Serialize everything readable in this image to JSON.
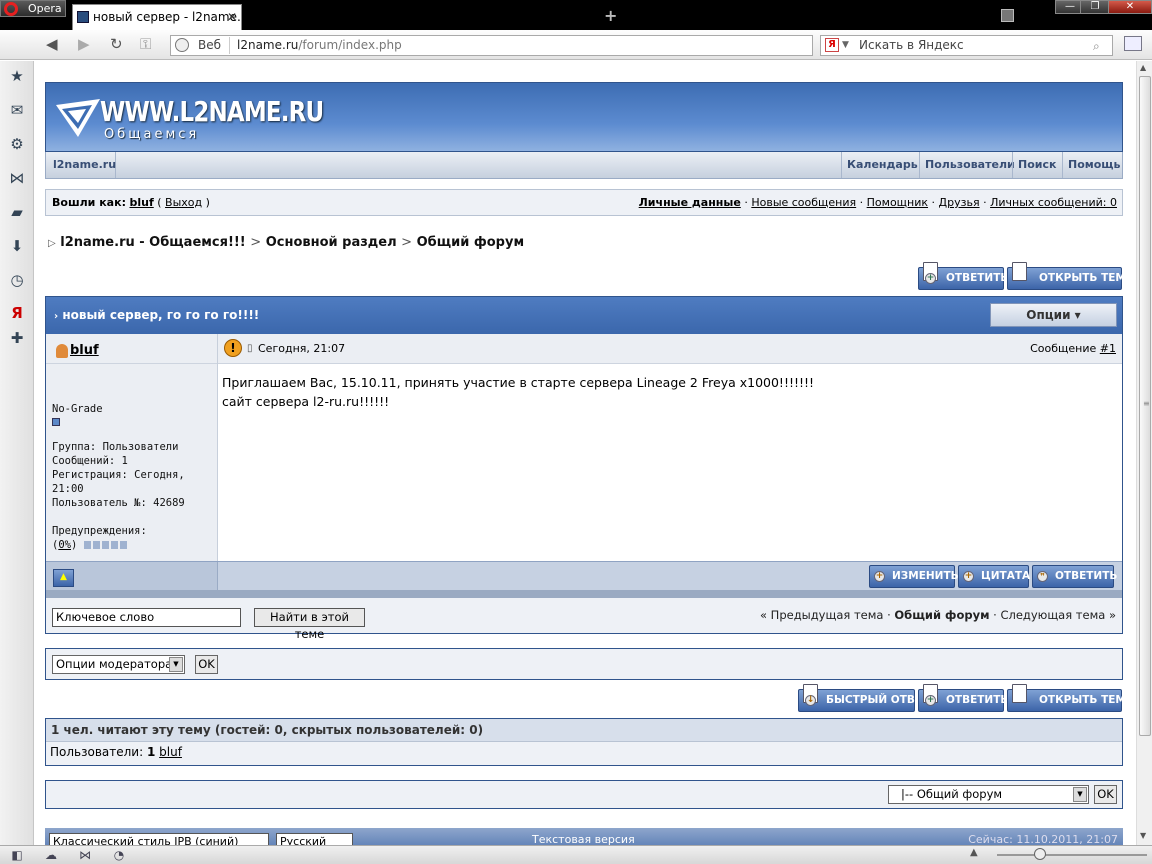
{
  "browser": {
    "menu_label": "Opera",
    "tab_title": "новый сервер - l2name....",
    "tab_close": "✕",
    "new_tab": "+",
    "window_buttons": [
      "—",
      "❐",
      "✕"
    ],
    "address_label": "Веб",
    "address_host": "l2name.ru",
    "address_path": "/forum/index.php",
    "search_engine": "Я",
    "search_placeholder": "Искать в Яндекс"
  },
  "sidebar": {
    "icons": [
      "star-icon",
      "mail-icon",
      "gear-icon",
      "unite-icon",
      "notes-icon",
      "downloads-icon",
      "history-icon",
      "yandex-icon",
      "plus-icon"
    ]
  },
  "forum": {
    "logo_title": "WWW.L2NAME.RU",
    "logo_subtitle": "Общаемся",
    "menu_home": "l2name.ru",
    "menu_items": [
      "Календарь",
      "Пользователи",
      "Поиск",
      "Помощь"
    ],
    "user_prefix": "Вошли как:",
    "username": "bluf",
    "paren_open": "(",
    "logout": "Выход",
    "paren_close": ")",
    "user_links": [
      "Личные данные",
      "Новые сообщения",
      "Помощник",
      "Друзья",
      "Личных сообщений: 0"
    ],
    "breadcrumb": [
      "l2name.ru - Общаемся!!!",
      "Основной раздел",
      "Общий форум"
    ],
    "breadcrumb_sep": ">",
    "breadcrumb_arrow": "▷",
    "reply_button": "ОТВЕТИТЬ",
    "new_topic_button": "ОТКРЫТЬ ТЕМУ",
    "quick_reply_button": "БЫСТРЫЙ ОТВЕТ",
    "topic_title": "новый сервер, го го го го!!!!",
    "topic_marker": "›",
    "options_label": "Опции ▾"
  },
  "post": {
    "author": "bluf",
    "time": "Сегодня, 21:07",
    "number_label": "Сообщение",
    "number_link": "#1",
    "warn_glyph": "!",
    "rank": "No-Grade",
    "group": "Группа: Пользователи",
    "posts": "Сообщений: 1",
    "reg_label": "Регистрация: Сегодня,",
    "reg_time": "21:00",
    "user_no": "Пользователь №: 42689",
    "warnings": "Предупреждения:",
    "warn_pct_open": "(",
    "warn_pct": "0%",
    "warn_pct_close": ")",
    "body_line1": "Приглашаем Вас, 15.10.11, принять участие в старте сервера Lineage 2 Freya x1000!!!!!!!",
    "body_line2": "сайт сервера l2-ru.ru!!!!!!",
    "edit_button": "ИЗМЕНИТЬ",
    "quote_button": "ЦИТАТА",
    "reply_button": "ОТВЕТИТЬ"
  },
  "search": {
    "keyword": "Ключевое слово",
    "button": "Найти в этой теме",
    "prev": "« Предыдущая тема",
    "dot": "·",
    "forum": "Общий форум",
    "next": "Следующая тема »"
  },
  "moderation": {
    "select": "Опции модератора",
    "ok": "OK"
  },
  "readers": {
    "header": "1 чел. читают эту тему (гостей: 0, скрытых пользователей: 0)",
    "users_label": "Пользователи:",
    "count": "1",
    "user": "bluf"
  },
  "jump": {
    "select": "|-- Общий форум",
    "ok": "OK"
  },
  "footer": {
    "skin": "Классический стиль IPB (синий)",
    "lang": "Русский",
    "text_version": "Текстовая версия",
    "date": "Сейчас: 11.10.2011, 21:07"
  }
}
